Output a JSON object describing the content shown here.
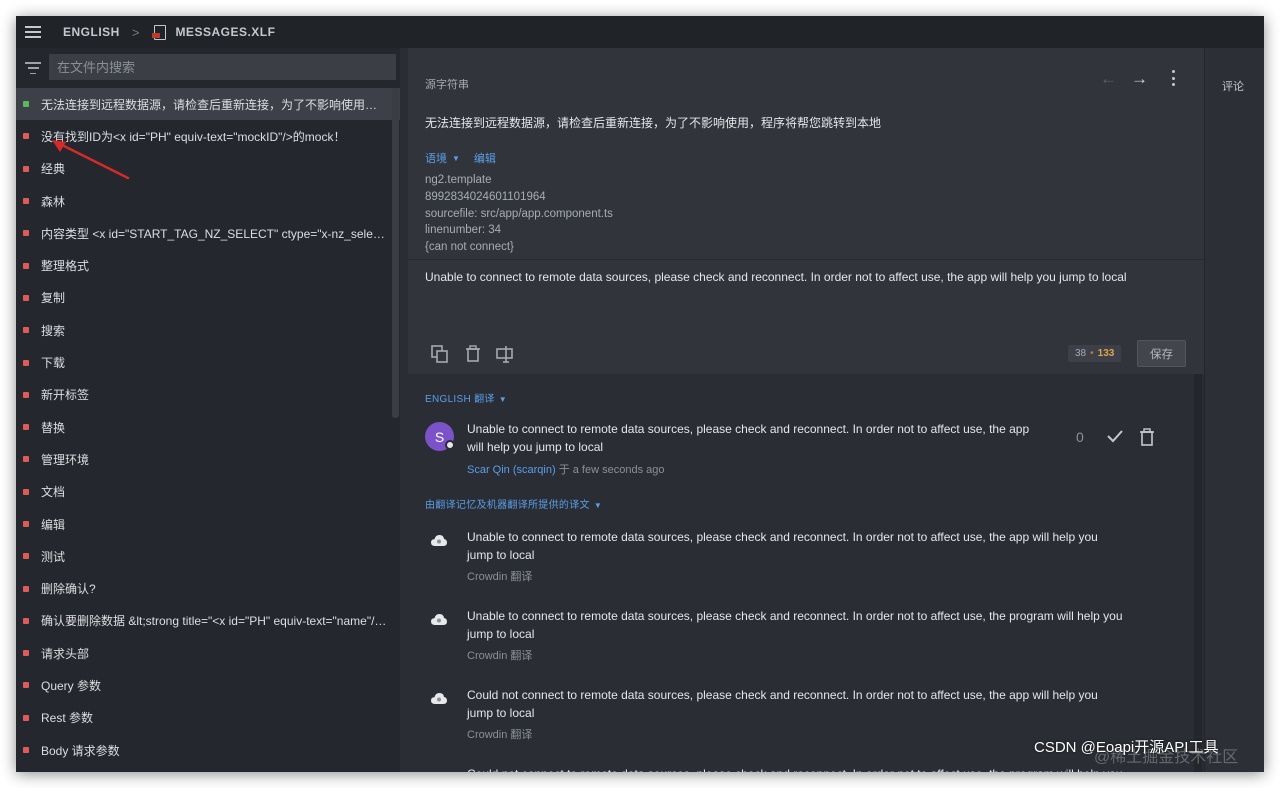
{
  "header": {
    "language": "ENGLISH",
    "separator": ">",
    "file_name": "MESSAGES.XLF"
  },
  "sidebar": {
    "search_placeholder": "在文件内搜索",
    "status_colors": {
      "translated": "#5cb85c",
      "untranslated": "#e05a5a"
    },
    "strings": [
      {
        "label": "无法连接到远程数据源，请检查后重新连接，为了不影响使用，程序将帮您跳转到本地",
        "status": "translated"
      },
      {
        "label": "没有找到ID为<x id=\"PH\" equiv-text=\"mockID\"/>的mock！",
        "status": "untranslated"
      },
      {
        "label": "经典",
        "status": "untranslated"
      },
      {
        "label": "森林",
        "status": "untranslated"
      },
      {
        "label": "内容类型 <x id=\"START_TAG_NZ_SELECT\" ctype=\"x-nz_select\" equiv-text=\"&lt;nz-select&gt;\"/>",
        "status": "untranslated"
      },
      {
        "label": "整理格式",
        "status": "untranslated"
      },
      {
        "label": "复制",
        "status": "untranslated"
      },
      {
        "label": "搜索",
        "status": "untranslated"
      },
      {
        "label": "下载",
        "status": "untranslated"
      },
      {
        "label": "新开标签",
        "status": "untranslated"
      },
      {
        "label": "替换",
        "status": "untranslated"
      },
      {
        "label": "管理环境",
        "status": "untranslated"
      },
      {
        "label": "文档",
        "status": "untranslated"
      },
      {
        "label": "编辑",
        "status": "untranslated"
      },
      {
        "label": "测试",
        "status": "untranslated"
      },
      {
        "label": "删除确认?",
        "status": "untranslated"
      },
      {
        "label": "确认要删除数据 &lt;strong title=\"<x id=\"PH\" equiv-text=\"name\"/>\"&gt;",
        "status": "untranslated"
      },
      {
        "label": "请求头部",
        "status": "untranslated"
      },
      {
        "label": "Query 参数",
        "status": "untranslated"
      },
      {
        "label": "Rest 参数",
        "status": "untranslated"
      },
      {
        "label": "Body 请求参数",
        "status": "untranslated"
      }
    ]
  },
  "editor": {
    "source_label": "源字符串",
    "source_text": "无法连接到远程数据源，请检查后重新连接，为了不影响使用，程序将帮您跳转到本地",
    "context_tab": "语境",
    "edit_tab": "编辑",
    "context_lines": [
      "ng2.template",
      "8992834024601101964",
      "sourcefile: src/app/app.component.ts",
      "linenumber: 34",
      "{can not connect}"
    ],
    "translation_value": "Unable to connect to remote data sources, please check and reconnect. In order not to affect use, the app will help you jump to local",
    "counter_source": "38",
    "counter_translation": "133",
    "save_label": "保存"
  },
  "suggestions": {
    "language_section": "ENGLISH 翻译",
    "user_translation": {
      "avatar_letter": "S",
      "text": "Unable to connect to remote data sources, please check and reconnect. In order not to affect use, the app will help you jump to local",
      "user": "Scar Qin (scarqin)",
      "time": "于 a few seconds ago",
      "votes": "0"
    },
    "mt_section": "由翻译记忆及机器翻译所提供的译文",
    "mt_items": [
      {
        "text": "Unable to connect to remote data sources, please check and reconnect. In order not to affect use, the app will help you jump to local",
        "source": "Crowdin 翻译"
      },
      {
        "text": "Unable to connect to remote data sources, please check and reconnect. In order not to affect use, the program will help you jump to local",
        "source": "Crowdin 翻译"
      },
      {
        "text": "Could not connect to remote data sources, please check and reconnect. In order not to affect use, the app will help you jump to local",
        "source": "Crowdin 翻译"
      },
      {
        "text": "Could not connect to remote data sources, please check and reconnect. In order not to affect use, the program will help you jump to local",
        "source": ""
      }
    ]
  },
  "right_rail": {
    "comments_label": "评论"
  },
  "watermark": {
    "text": "CSDN @Eoapi开源API工具",
    "faint_text": "@稀土掘金技术社区"
  }
}
